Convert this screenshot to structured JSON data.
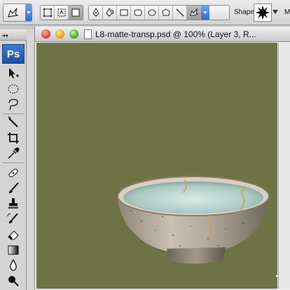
{
  "options_bar": {
    "shape_label": "Shape:",
    "overflow_label": "M"
  },
  "tools_panel": {
    "logo": "Ps",
    "collapse_glyph": "◂◂"
  },
  "document": {
    "title": "L8-matte-transp.psd @ 100% (Layer 3, R..."
  },
  "colors": {
    "canvas_background": "#6e7346",
    "accent": "#2f6fd6"
  }
}
